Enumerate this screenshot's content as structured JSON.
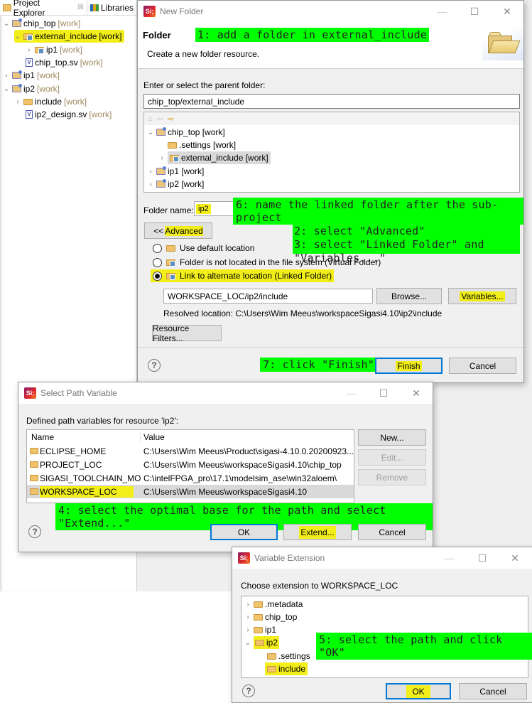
{
  "project_explorer": {
    "tabs": [
      {
        "label": "Project Explorer",
        "icon": "project-explorer-icon",
        "close": "☒"
      },
      {
        "label": "Libraries",
        "icon": "libraries-icon"
      }
    ],
    "tree": [
      {
        "label": "chip_top",
        "suffix": "[work]",
        "expanded": true,
        "icon": "project-icon",
        "level": 0
      },
      {
        "label": "external_include",
        "suffix": "[work]",
        "expanded": true,
        "icon": "linked-folder-icon",
        "level": 1,
        "highlighted": true
      },
      {
        "label": "ip1",
        "suffix": "[work]",
        "expanded": false,
        "icon": "linked-folder-icon",
        "level": 2
      },
      {
        "label": "chip_top.sv",
        "suffix": "[work]",
        "icon": "sv-file-icon",
        "level": 1
      },
      {
        "label": "ip1",
        "suffix": "[work]",
        "expanded": false,
        "icon": "project-icon",
        "level": 0
      },
      {
        "label": "ip2",
        "suffix": "[work]",
        "expanded": true,
        "icon": "project-icon",
        "level": 0
      },
      {
        "label": "include",
        "suffix": "[work]",
        "expanded": false,
        "icon": "folder-icon",
        "level": 1
      },
      {
        "label": "ip2_design.sv",
        "suffix": "[work]",
        "icon": "sv-file-icon",
        "level": 1
      }
    ]
  },
  "new_folder_dialog": {
    "title": "New Folder",
    "logo": "Si;",
    "header_title": "Folder",
    "header_desc": "Create a new folder resource.",
    "parent_label": "Enter or select the parent folder:",
    "parent_value": "chip_top/external_include",
    "tree": [
      {
        "label": "chip_top [work]",
        "expanded": true,
        "level": 0,
        "icon": "project-icon"
      },
      {
        "label": ".settings [work]",
        "level": 1,
        "icon": "folder-icon"
      },
      {
        "label": "external_include [work]",
        "expanded": false,
        "level": 1,
        "icon": "linked-folder-icon",
        "selected": true
      },
      {
        "label": "ip1 [work]",
        "expanded": false,
        "level": 0,
        "icon": "project-icon"
      },
      {
        "label": "ip2 [work]",
        "expanded": false,
        "level": 0,
        "icon": "project-icon"
      }
    ],
    "folder_name_label": "Folder name:",
    "folder_name_value": "ip2",
    "advanced_button": "<< Advanced",
    "advanced_prefix": "<<",
    "advanced_text": "Advanced",
    "options": [
      {
        "label": "Use default location",
        "selected": false,
        "icon": "folder-icon"
      },
      {
        "label": "Folder is not located in the file system (Virtual Folder)",
        "selected": false,
        "icon": "virtual-folder-icon"
      },
      {
        "label": "Link to alternate location (Linked Folder)",
        "selected": true,
        "icon": "linked-folder-icon"
      }
    ],
    "location_value": "WORKSPACE_LOC/ip2/include",
    "browse_button": "Browse...",
    "variables_button": "Variables...",
    "resolved_location": "Resolved location: C:\\Users\\Wim Meeus\\workspaceSigasi4.10\\ip2\\include",
    "resource_filters_button": "Resource Filters...",
    "finish_button": "Finish",
    "cancel_button": "Cancel",
    "help": "?"
  },
  "select_path_variable_dialog": {
    "title": "Select Path Variable",
    "logo": "Si;",
    "label": "Defined path variables for resource 'ip2':",
    "columns": [
      "Name",
      "Value"
    ],
    "rows": [
      {
        "name": "ECLIPSE_HOME",
        "value": "C:\\Users\\Wim Meeus\\Product\\sigasi-4.10.0.20200923..."
      },
      {
        "name": "PROJECT_LOC",
        "value": "C:\\Users\\Wim Meeus\\workspaceSigasi4.10\\chip_top"
      },
      {
        "name": "SIGASI_TOOLCHAIN_MO...",
        "value": "C:\\intelFPGA_pro\\17.1\\modelsim_ase\\win32aloem\\"
      },
      {
        "name": "WORKSPACE_LOC",
        "value": "C:\\Users\\Wim Meeus\\workspaceSigasi4.10",
        "selected": true
      }
    ],
    "new_button": "New...",
    "edit_button": "Edit...",
    "remove_button": "Remove",
    "ok_button": "OK",
    "extend_button": "Extend...",
    "cancel_button": "Cancel",
    "help": "?"
  },
  "variable_extension_dialog": {
    "title": "Variable Extension",
    "logo": "Si;",
    "label": "Choose extension to WORKSPACE_LOC",
    "tree": [
      {
        "label": ".metadata",
        "expanded": false,
        "level": 0
      },
      {
        "label": "chip_top",
        "expanded": false,
        "level": 0
      },
      {
        "label": "ip1",
        "expanded": false,
        "level": 0
      },
      {
        "label": "ip2",
        "expanded": true,
        "level": 0,
        "highlighted": true
      },
      {
        "label": ".settings",
        "level": 1
      },
      {
        "label": "include",
        "level": 1,
        "highlighted": true
      }
    ],
    "ok_button": "OK",
    "cancel_button": "Cancel",
    "help": "?"
  },
  "annotations": {
    "step1": "1: add a folder in external_include",
    "step2": "2: select \"Advanced\"",
    "step3": "3: select \"Linked Folder\" and \"Variables...\"",
    "step4": "4: select the optimal base for the path and select \"Extend...\"",
    "step5": "5: select the path and click \"OK\"",
    "step6": "6: name the linked folder after the sub-project",
    "step7": "7: click \"Finish\""
  },
  "window_controls": {
    "minimize": "—",
    "maximize": "☐",
    "close": "✕"
  },
  "colors": {
    "highlight": "#f2ee1a",
    "annotation": "#00ff00",
    "default_button": "#0078d7",
    "work_suffix": "#a08a60"
  }
}
